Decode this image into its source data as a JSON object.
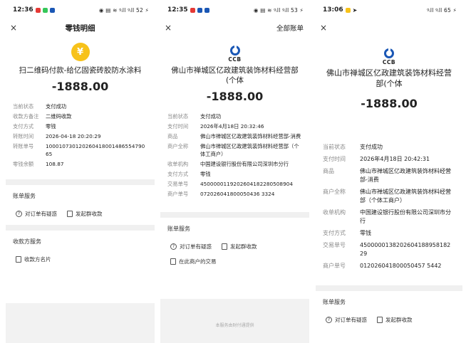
{
  "colors": {
    "accent_blue": "#1a57b5",
    "coin_yellow": "#f7c21a",
    "status_red": "#e53935",
    "status_green": "#35c759"
  },
  "p1": {
    "status_time": "12:36",
    "status_right": "◉ ▤ ≋ ᵍᵢll ᵍᵢll 52 ⚡",
    "close": "×",
    "title": "零钱明细",
    "merchant": "扫二维码付款-给亿固瓷砖胶防水涂料",
    "amount": "-1888.00",
    "rows": [
      {
        "k": "当前状态",
        "v": "支付成功"
      },
      {
        "k": "收款方备注",
        "v": "二维码收款"
      },
      {
        "k": "支付方式",
        "v": "零钱"
      },
      {
        "k": "转账时间",
        "v": "2026-04-18 20:20:29"
      },
      {
        "k": "转账单号",
        "v": "10001073012026041800148655479065"
      },
      {
        "k": "零钱余额",
        "v": "108.87"
      }
    ],
    "section1": "账单服务",
    "action1": "对订单有疑惑",
    "action2": "发起群收款",
    "section2": "收款方服务",
    "action3": "收款方名片"
  },
  "p2": {
    "status_time": "12:35",
    "status_right": "◉ ▤ ≋ ᵍᵢll ᵍᵢll 53 ⚡",
    "close": "×",
    "right_link": "全部账单",
    "logo_text": "CCB",
    "merchant": "佛山市禅城区亿政建筑装饰材料经营部(个体",
    "amount": "-1888.00",
    "rows": [
      {
        "k": "当前状态",
        "v": "支付成功"
      },
      {
        "k": "支付时间",
        "v": "2026年4月18日 20:32:46"
      },
      {
        "k": "商品",
        "v": "佛山市禅城区亿政建筑装饰材料经营部-消费"
      },
      {
        "k": "商户全称",
        "v": "佛山市禅城区亿政建筑装饰材料经营部（个体工商户）"
      },
      {
        "k": "收单机构",
        "v": "中国建设银行股份有限公司深圳市分行"
      },
      {
        "k": "支付方式",
        "v": "零钱"
      },
      {
        "k": "交易单号",
        "v": "4500000119202604182280508904"
      },
      {
        "k": "商户单号",
        "v": "072026041800050436 3324"
      }
    ],
    "section1": "账单服务",
    "action1": "对订单有疑惑",
    "action2": "发起群收款",
    "action3": "在此商户的交易",
    "footnote": "本服务由财付通提供"
  },
  "p3": {
    "status_time": "13:06",
    "status_right": "ᵍᵢll ᵍᵢll 65 ⚡",
    "close": "×",
    "logo_text": "CCB",
    "merchant": "佛山市禅城区亿政建筑装饰材料经营部(个体",
    "amount": "-1888.00",
    "rows": [
      {
        "k": "当前状态",
        "v": "支付成功"
      },
      {
        "k": "支付时间",
        "v": "2026年4月18日 20:42:31"
      },
      {
        "k": "商品",
        "v": "佛山市禅城区亿政建筑装饰材料经营部-消费"
      },
      {
        "k": "商户全称",
        "v": "佛山市禅城区亿政建筑装饰材料经营部（个体工商户）"
      },
      {
        "k": "收单机构",
        "v": "中国建设银行股份有限公司深圳市分行"
      },
      {
        "k": "支付方式",
        "v": "零钱"
      },
      {
        "k": "交易单号",
        "v": "4500000138202604188958182 29"
      },
      {
        "k": "商户单号",
        "v": "012026041800050457 5442"
      }
    ],
    "section1": "账单服务",
    "action1": "对订单有疑惑",
    "action2": "发起群收款"
  }
}
